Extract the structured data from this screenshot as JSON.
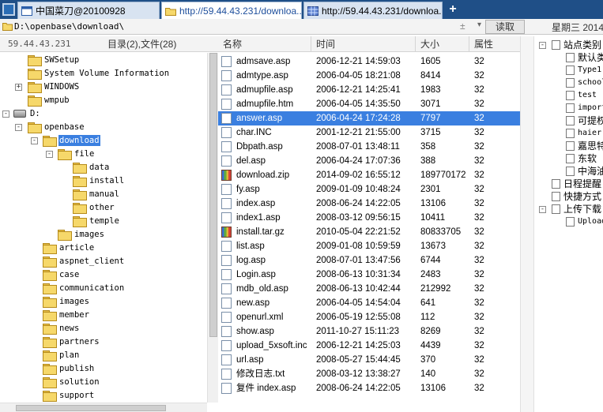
{
  "tabs": [
    {
      "label": "中国菜刀@20100928"
    },
    {
      "label": "http://59.44.43.231/downloa..."
    },
    {
      "label": "http://59.44.43.231/downloa..."
    }
  ],
  "new_tab_label": "+",
  "address": {
    "path": "D:\\openbase\\download\\",
    "updown": "±",
    "dropdown": "▾",
    "read_button": "读取",
    "date": "星期三 2014"
  },
  "left_header": {
    "ip": "59.44.43.231",
    "counts": "目录(2),文件(28)"
  },
  "columns": {
    "name": "名称",
    "time": "时间",
    "size": "大小",
    "attr": "属性"
  },
  "tree": [
    {
      "label": "SWSetup",
      "toggle": ""
    },
    {
      "label": "System Volume Information",
      "toggle": ""
    },
    {
      "label": "WINDOWS",
      "toggle": "+"
    },
    {
      "label": "wmpub",
      "toggle": ""
    },
    {
      "label": "D:",
      "toggle": "-"
    },
    {
      "label": "openbase",
      "toggle": "-"
    },
    {
      "label": "download",
      "toggle": "-"
    },
    {
      "label": "file",
      "toggle": "-"
    },
    {
      "label": "data",
      "toggle": ""
    },
    {
      "label": "install",
      "toggle": ""
    },
    {
      "label": "manual",
      "toggle": ""
    },
    {
      "label": "other",
      "toggle": ""
    },
    {
      "label": "temple",
      "toggle": ""
    },
    {
      "label": "images",
      "toggle": ""
    },
    {
      "label": "article",
      "toggle": ""
    },
    {
      "label": "aspnet_client",
      "toggle": ""
    },
    {
      "label": "case",
      "toggle": ""
    },
    {
      "label": "communication",
      "toggle": ""
    },
    {
      "label": "images",
      "toggle": ""
    },
    {
      "label": "member",
      "toggle": ""
    },
    {
      "label": "news",
      "toggle": ""
    },
    {
      "label": "partners",
      "toggle": ""
    },
    {
      "label": "plan",
      "toggle": ""
    },
    {
      "label": "publish",
      "toggle": ""
    },
    {
      "label": "solution",
      "toggle": ""
    },
    {
      "label": "support",
      "toggle": ""
    }
  ],
  "files": [
    {
      "name": "admsave.asp",
      "time": "2006-12-21 14:59:03",
      "size": "1605",
      "attr": "32",
      "icon": "file-icon"
    },
    {
      "name": "admtype.asp",
      "time": "2006-04-05 18:21:08",
      "size": "8414",
      "attr": "32",
      "icon": "file-icon"
    },
    {
      "name": "admupfile.asp",
      "time": "2006-12-21 14:25:41",
      "size": "1983",
      "attr": "32",
      "icon": "file-icon"
    },
    {
      "name": "admupfile.htm",
      "time": "2006-04-05 14:35:50",
      "size": "3071",
      "attr": "32",
      "icon": "file-icon"
    },
    {
      "name": "answer.asp",
      "time": "2006-04-24 17:24:28",
      "size": "7797",
      "attr": "32",
      "icon": "file-icon"
    },
    {
      "name": "char.INC",
      "time": "2001-12-21 21:55:00",
      "size": "3715",
      "attr": "32",
      "icon": "file-icon"
    },
    {
      "name": "Dbpath.asp",
      "time": "2008-07-01 13:48:11",
      "size": "358",
      "attr": "32",
      "icon": "file-icon"
    },
    {
      "name": "del.asp",
      "time": "2006-04-24 17:07:36",
      "size": "388",
      "attr": "32",
      "icon": "file-icon"
    },
    {
      "name": "download.zip",
      "time": "2014-09-02 16:55:12",
      "size": "189770172",
      "attr": "32",
      "icon": "archive-icon"
    },
    {
      "name": "fy.asp",
      "time": "2009-01-09 10:48:24",
      "size": "2301",
      "attr": "32",
      "icon": "file-icon"
    },
    {
      "name": "index.asp",
      "time": "2008-06-24 14:22:05",
      "size": "13106",
      "attr": "32",
      "icon": "file-icon"
    },
    {
      "name": "index1.asp",
      "time": "2008-03-12 09:56:15",
      "size": "10411",
      "attr": "32",
      "icon": "file-icon"
    },
    {
      "name": "install.tar.gz",
      "time": "2010-05-04 22:21:52",
      "size": "80833705",
      "attr": "32",
      "icon": "archive-icon"
    },
    {
      "name": "list.asp",
      "time": "2009-01-08 10:59:59",
      "size": "13673",
      "attr": "32",
      "icon": "file-icon"
    },
    {
      "name": "log.asp",
      "time": "2008-07-01 13:47:56",
      "size": "6744",
      "attr": "32",
      "icon": "file-icon"
    },
    {
      "name": "Login.asp",
      "time": "2008-06-13 10:31:34",
      "size": "2483",
      "attr": "32",
      "icon": "file-icon"
    },
    {
      "name": "mdb_old.asp",
      "time": "2008-06-13 10:42:44",
      "size": "212992",
      "attr": "32",
      "icon": "file-icon"
    },
    {
      "name": "new.asp",
      "time": "2006-04-05 14:54:04",
      "size": "641",
      "attr": "32",
      "icon": "file-icon"
    },
    {
      "name": "openurl.xml",
      "time": "2006-05-19 12:55:08",
      "size": "112",
      "attr": "32",
      "icon": "file-icon"
    },
    {
      "name": "show.asp",
      "time": "2011-10-27 15:11:23",
      "size": "8269",
      "attr": "32",
      "icon": "file-icon"
    },
    {
      "name": "upload_5xsoft.inc",
      "time": "2006-12-21 14:25:03",
      "size": "4439",
      "attr": "32",
      "icon": "file-icon"
    },
    {
      "name": "url.asp",
      "time": "2008-05-27 15:44:45",
      "size": "370",
      "attr": "32",
      "icon": "file-icon"
    },
    {
      "name": "修改日志.txt",
      "time": "2008-03-12 13:38:27",
      "size": "140",
      "attr": "32",
      "icon": "file-icon"
    },
    {
      "name": "复件 index.asp",
      "time": "2008-06-24 14:22:05",
      "size": "13106",
      "attr": "32",
      "icon": "file-icon"
    }
  ],
  "right_panel": [
    {
      "label": "站点类别",
      "toggle": "-",
      "mono": false
    },
    {
      "label": "默认类",
      "toggle": "",
      "mono": false
    },
    {
      "label": "Type1",
      "toggle": "",
      "mono": true
    },
    {
      "label": "school",
      "toggle": "",
      "mono": true
    },
    {
      "label": "test",
      "toggle": "",
      "mono": true
    },
    {
      "label": "import",
      "toggle": "",
      "mono": true
    },
    {
      "label": "可提权",
      "toggle": "",
      "mono": false
    },
    {
      "label": "haier",
      "toggle": "",
      "mono": true
    },
    {
      "label": "嘉思特",
      "toggle": "",
      "mono": false
    },
    {
      "label": "东软",
      "toggle": "",
      "mono": false
    },
    {
      "label": "中海油",
      "toggle": "",
      "mono": false
    },
    {
      "label": "日程提醒",
      "toggle": "",
      "mono": false
    },
    {
      "label": "快捷方式",
      "toggle": "",
      "mono": false
    },
    {
      "label": "上传下载",
      "toggle": "-",
      "mono": false
    },
    {
      "label": "Upload",
      "toggle": "",
      "mono": true
    }
  ]
}
